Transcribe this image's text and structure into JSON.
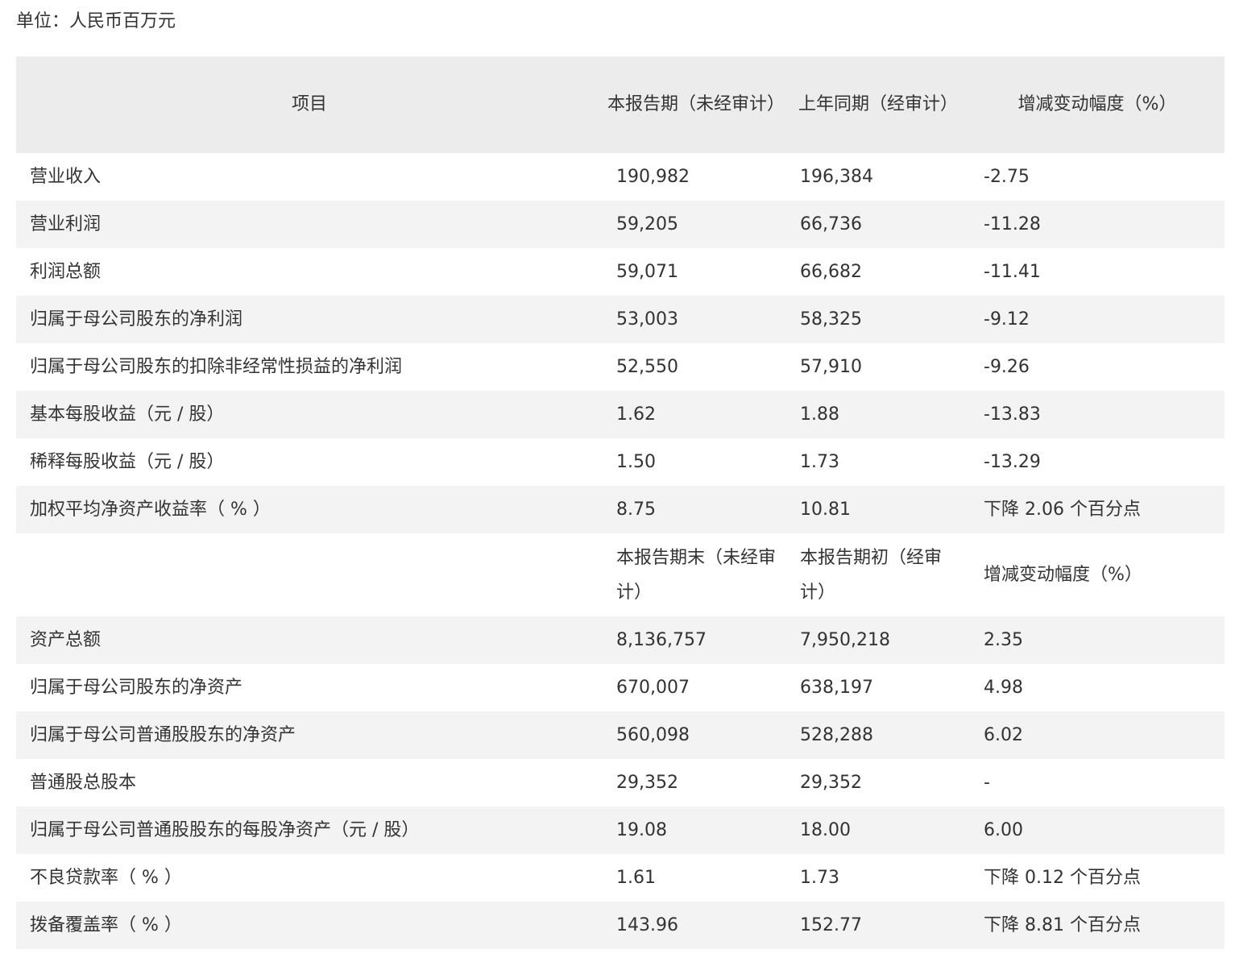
{
  "unit_label": "单位：人民币百万元",
  "header": {
    "item": "项目",
    "current": "本报告期（未经审计）",
    "prior": "上年同期（经审计）",
    "change": "增减变动幅度（%）"
  },
  "income_rows": [
    {
      "item": "营业收入",
      "current": "190,982",
      "prior": "196,384",
      "change": "-2.75"
    },
    {
      "item": "营业利润",
      "current": "59,205",
      "prior": "66,736",
      "change": "-11.28"
    },
    {
      "item": "利润总额",
      "current": "59,071",
      "prior": "66,682",
      "change": "-11.41"
    },
    {
      "item": "归属于母公司股东的净利润",
      "current": "53,003",
      "prior": "58,325",
      "change": "-9.12"
    },
    {
      "item": "归属于母公司股东的扣除非经常性损益的净利润",
      "current": "52,550",
      "prior": "57,910",
      "change": "-9.26"
    },
    {
      "item": "基本每股收益（元 / 股）",
      "current": "1.62",
      "prior": "1.88",
      "change": "-13.83"
    },
    {
      "item": "稀释每股收益（元 / 股）",
      "current": "1.50",
      "prior": "1.73",
      "change": "-13.29"
    },
    {
      "item": "加权平均净资产收益率（ % ）",
      "current": "8.75",
      "prior": "10.81",
      "change": "下降 2.06 个百分点"
    }
  ],
  "subheader": {
    "item": "",
    "current": "本报告期末（未经审计）",
    "prior": "本报告期初（经审计）",
    "change": "增减变动幅度（%）"
  },
  "balance_rows": [
    {
      "item": "资产总额",
      "current": "8,136,757",
      "prior": "7,950,218",
      "change": "2.35"
    },
    {
      "item": "归属于母公司股东的净资产",
      "current": "670,007",
      "prior": "638,197",
      "change": "4.98"
    },
    {
      "item": "归属于母公司普通股股东的净资产",
      "current": "560,098",
      "prior": "528,288",
      "change": "6.02"
    },
    {
      "item": "普通股总股本",
      "current": "29,352",
      "prior": "29,352",
      "change": "-"
    },
    {
      "item": "归属于母公司普通股股东的每股净资产（元 / 股）",
      "current": "19.08",
      "prior": "18.00",
      "change": "6.00"
    },
    {
      "item": "不良贷款率（ % ）",
      "current": "1.61",
      "prior": "1.73",
      "change": "下降 0.12 个百分点"
    },
    {
      "item": "拨备覆盖率（ % ）",
      "current": "143.96",
      "prior": "152.77",
      "change": "下降 8.81 个百分点"
    }
  ]
}
